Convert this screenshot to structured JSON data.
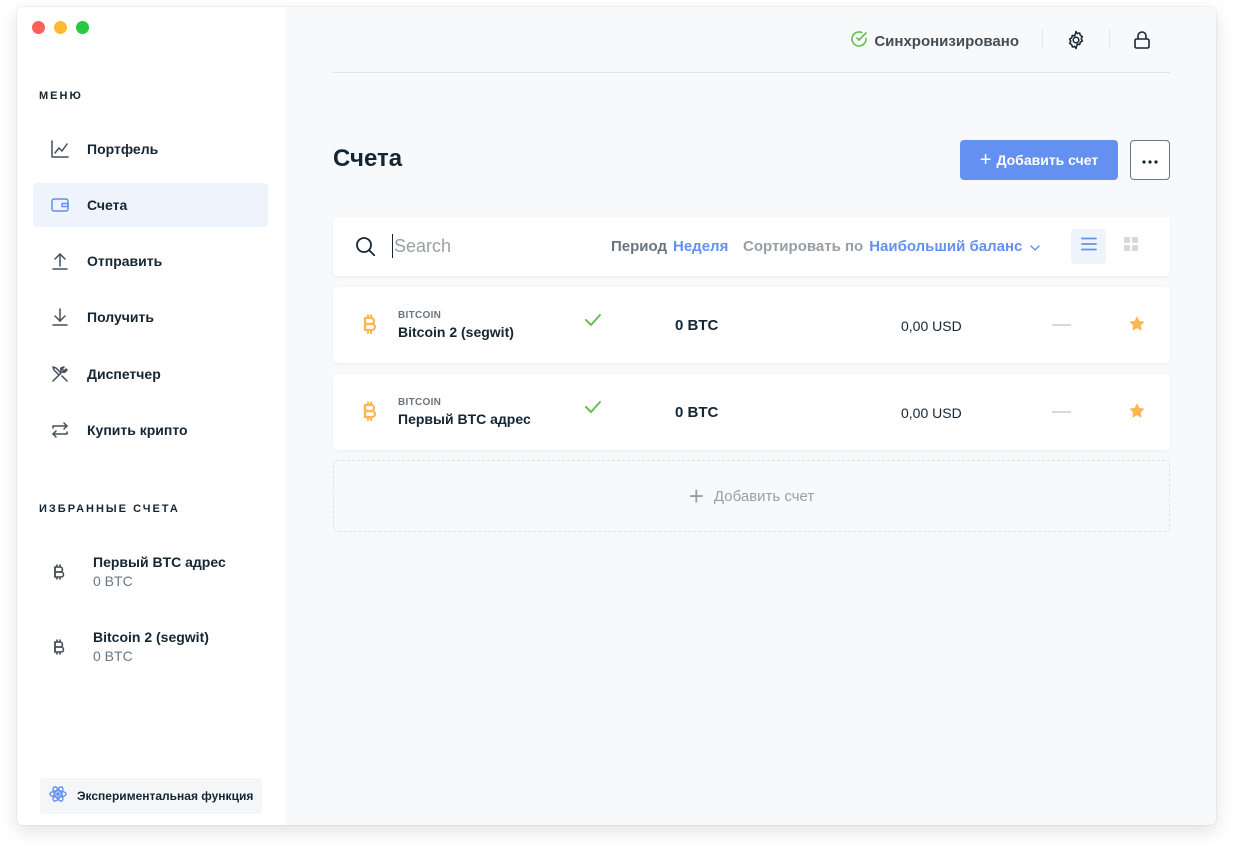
{
  "window": {
    "traffic_colors": [
      "#fe5f57",
      "#febc2e",
      "#28c840"
    ]
  },
  "sidebar": {
    "menu_title": "МЕНЮ",
    "items": [
      {
        "label": "Портфель",
        "icon": "chart-line-icon"
      },
      {
        "label": "Счета",
        "icon": "wallet-icon",
        "active": true
      },
      {
        "label": "Отправить",
        "icon": "arrow-up-icon"
      },
      {
        "label": "Получить",
        "icon": "arrow-down-icon"
      },
      {
        "label": "Диспетчер",
        "icon": "tools-icon"
      },
      {
        "label": "Купить крипто",
        "icon": "exchange-icon"
      }
    ],
    "favorites_title": "ИЗБРАННЫЕ СЧЕТА",
    "favorites": [
      {
        "name": "Первый BTC адрес",
        "balance": "0 BTC"
      },
      {
        "name": "Bitcoin 2 (segwit)",
        "balance": "0 BTC"
      }
    ],
    "experimental_label": "Экспериментальная функция"
  },
  "topbar": {
    "sync_label": "Синхронизировано",
    "sync_color": "#66be54"
  },
  "main": {
    "title": "Счета",
    "add_button_label": "Добавить счет",
    "accent_color": "#6490f1",
    "search_placeholder": "Search",
    "period_label": "Период",
    "period_value": "Неделя",
    "sort_label": "Сортировать по",
    "sort_value": "Наибольший баланс",
    "accounts": [
      {
        "currency": "BITCOIN",
        "name": "Bitcoin 2 (segwit)",
        "balance": "0 BTC",
        "fiat": "0,00 USD",
        "starred": true
      },
      {
        "currency": "BITCOIN",
        "name": "Первый BTC адрес",
        "balance": "0 BTC",
        "fiat": "0,00 USD",
        "starred": true
      }
    ],
    "add_row_label": "Добавить счет"
  }
}
